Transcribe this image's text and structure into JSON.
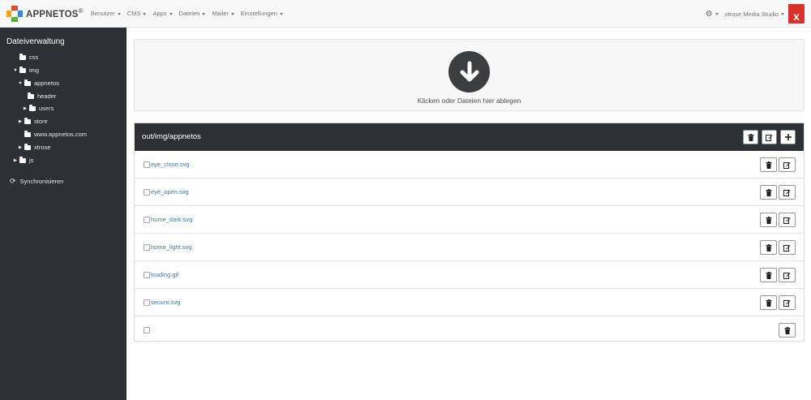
{
  "brand": {
    "name": "APPNETOS",
    "mark": "®"
  },
  "nav": [
    {
      "label": "Benutzer"
    },
    {
      "label": "CMS"
    },
    {
      "label": "Apps"
    },
    {
      "label": "Dateien"
    },
    {
      "label": "Mailer"
    },
    {
      "label": "Einstellungen"
    }
  ],
  "account": {
    "studio": "xtrose Media Studio",
    "avatar_letter": "x",
    "avatar_color": "#d9302a"
  },
  "sidebar": {
    "title": "Dateiverwaltung",
    "tree": [
      {
        "label": "css"
      },
      {
        "label": "img"
      },
      {
        "label": "appnetos"
      },
      {
        "label": "header"
      },
      {
        "label": "users"
      },
      {
        "label": "store"
      },
      {
        "label": "www.appnetos.com"
      },
      {
        "label": "xtrose"
      },
      {
        "label": "js"
      }
    ],
    "sync_label": "Synchronisieren"
  },
  "dropzone": {
    "text": "Klicken oder Dateien hier ablegen",
    "icon": "arrow-down-circle-icon"
  },
  "panel": {
    "path": "out/img/appnetos",
    "files": [
      {
        "name": "eye_close.svg"
      },
      {
        "name": "eye_open.svg"
      },
      {
        "name": "home_dark.svg"
      },
      {
        "name": "home_light.svg"
      },
      {
        "name": "loading.gif"
      },
      {
        "name": "secure.svg"
      },
      {
        "name": ""
      }
    ]
  },
  "colors": {
    "dark": "#2d3035",
    "link": "#3a7cc2"
  }
}
